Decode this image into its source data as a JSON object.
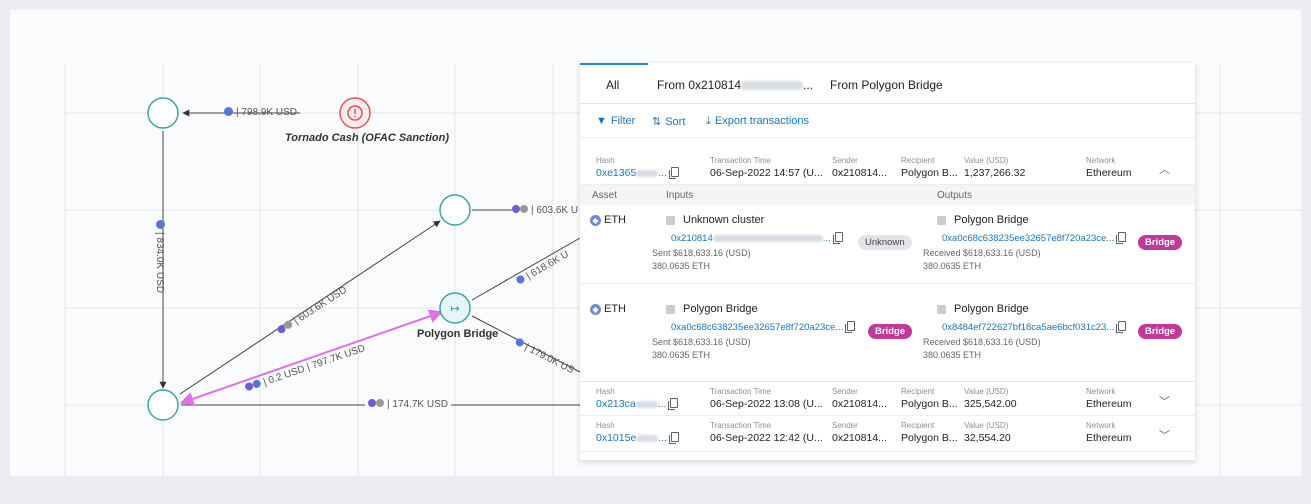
{
  "graph": {
    "edges": [
      {
        "id": "e1",
        "label": "| 798.9K USD",
        "tokens": [
          "#5575d8"
        ]
      },
      {
        "id": "e2",
        "label": "| 834.0K USD",
        "tokens": [
          "#5575d8"
        ]
      },
      {
        "id": "e3",
        "label": "| 603.6K U",
        "tokens": [
          "#6f5bd6",
          "#888"
        ]
      },
      {
        "id": "e4",
        "label": "| 603.6K USD",
        "tokens": [
          "#6f5bd6",
          "#888"
        ]
      },
      {
        "id": "e5",
        "label": "| 0.2 USD | 797.7K USD",
        "tokens": [
          "#6f5bd6",
          "#5575d8"
        ]
      },
      {
        "id": "e6",
        "label": "| 618.6K U",
        "tokens": [
          "#5575d8"
        ]
      },
      {
        "id": "e7",
        "label": "| 179.0K US",
        "tokens": [
          "#5575d8"
        ]
      },
      {
        "id": "e8",
        "label": "| 174.7K USD",
        "tokens": [
          "#6f5bd6",
          "#888"
        ]
      }
    ],
    "nodes": {
      "tornado_label": "Tornado Cash (OFAC Sanction)",
      "polygon_label": "Polygon Bridge"
    },
    "colors": {
      "highlight_edge": "#e070e8",
      "node_stroke": "#3aa5a5",
      "tornado": "#e05555"
    }
  },
  "panel": {
    "tabs": [
      {
        "label": "All"
      },
      {
        "label": "From 0x210814",
        "suffix": "..."
      },
      {
        "label": "From Polygon Bridge"
      }
    ],
    "toolbar": {
      "filter": "Filter",
      "sort": "Sort",
      "export": "Export transactions"
    },
    "col_headers": {
      "hash": "Hash",
      "time": "Transaction Time",
      "sender": "Sender",
      "recipient": "Recipient",
      "value": "Value (USD)",
      "network": "Network"
    },
    "transactions": [
      {
        "hash": "0xe1365",
        "time": "06-Sep-2022 14:57 (U...",
        "sender": "0x210814...",
        "recipient": "Polygon B...",
        "value": "1,237,266.32",
        "network": "Ethereum",
        "expanded": true
      },
      {
        "hash": "0x213ca",
        "time": "06-Sep-2022 13:08 (U...",
        "sender": "0x210814...",
        "recipient": "Polygon B...",
        "value": "325,542.00",
        "network": "Ethereum",
        "expanded": false
      },
      {
        "hash": "0x1015e",
        "time": "06-Sep-2022 12:42 (U...",
        "sender": "0x210814...",
        "recipient": "Polygon B...",
        "value": "32,554.20",
        "network": "Ethereum",
        "expanded": false
      }
    ],
    "io_headers": {
      "asset": "Asset",
      "inputs": "Inputs",
      "outputs": "Outputs"
    },
    "io_rows": [
      {
        "asset": "ETH",
        "input": {
          "name": "Unknown cluster",
          "addr": "0x210814",
          "sent": "Sent $618,633.16 (USD)",
          "eth": "380.0635 ETH",
          "badge": "Unknown"
        },
        "output": {
          "name": "Polygon Bridge",
          "addr": "0xa0c68c638235ee32657e8f720a23ce...",
          "sent": "Received $618,633.16 (USD)",
          "eth": "380.0635 ETH",
          "badge": "Bridge"
        }
      },
      {
        "asset": "ETH",
        "input": {
          "name": "Polygon Bridge",
          "addr": "0xa0c68c638235ee32657e8f720a23ce...",
          "sent": "Sent $618,633.16 (USD)",
          "eth": "380.0635 ETH",
          "badge": "Bridge"
        },
        "output": {
          "name": "Polygon Bridge",
          "addr": "0x8484ef722627bf18ca5ae6bcf031c23...",
          "sent": "Received $618,633.16 (USD)",
          "eth": "380.0635 ETH",
          "badge": "Bridge"
        }
      }
    ]
  }
}
